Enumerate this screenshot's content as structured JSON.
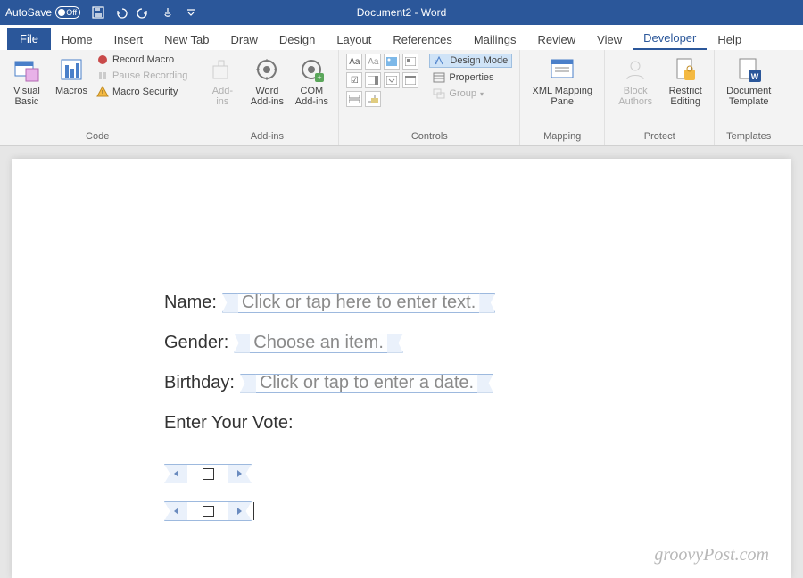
{
  "titlebar": {
    "autosave_label": "AutoSave",
    "autosave_state": "Off",
    "document_title": "Document2 - Word"
  },
  "tabs": {
    "file": "File",
    "home": "Home",
    "insert": "Insert",
    "newtab": "New Tab",
    "draw": "Draw",
    "design": "Design",
    "layout": "Layout",
    "references": "References",
    "mailings": "Mailings",
    "review": "Review",
    "view": "View",
    "developer": "Developer",
    "help": "Help"
  },
  "ribbon": {
    "code": {
      "visual_basic": "Visual\nBasic",
      "macros": "Macros",
      "record_macro": "Record Macro",
      "pause_recording": "Pause Recording",
      "macro_security": "Macro Security",
      "group_label": "Code"
    },
    "addins": {
      "addins": "Add-\nins",
      "word_addins": "Word\nAdd-ins",
      "com_addins": "COM\nAdd-ins",
      "group_label": "Add-ins"
    },
    "controls": {
      "design_mode": "Design Mode",
      "properties": "Properties",
      "group": "Group",
      "group_label": "Controls"
    },
    "mapping": {
      "xml_mapping": "XML Mapping\nPane",
      "group_label": "Mapping"
    },
    "protect": {
      "block_authors": "Block\nAuthors",
      "restrict_editing": "Restrict\nEditing",
      "group_label": "Protect"
    },
    "templates": {
      "doc_template": "Document\nTemplate",
      "group_label": "Templates"
    }
  },
  "document": {
    "fields": {
      "name_label": "Name:",
      "name_placeholder": "Click or tap here to enter text.",
      "gender_label": "Gender:",
      "gender_placeholder": "Choose an item.",
      "birthday_label": "Birthday:",
      "birthday_placeholder": "Click or tap to enter a date.",
      "vote_label": "Enter Your Vote:"
    }
  },
  "watermark": "groovyPost.com"
}
